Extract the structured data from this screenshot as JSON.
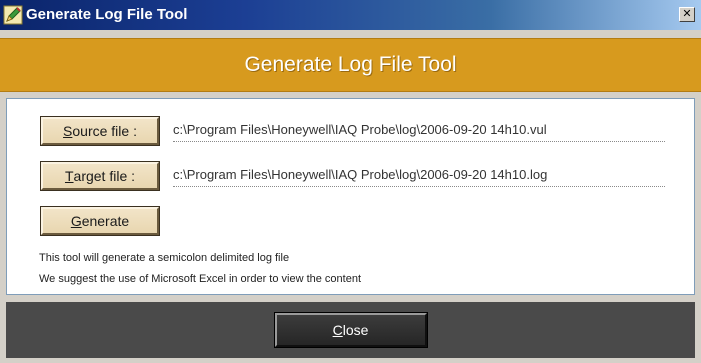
{
  "window": {
    "title": "Generate Log File Tool",
    "app_icon": "pen-tool-icon",
    "close_glyph": "✕"
  },
  "header": {
    "title": "Generate Log File Tool",
    "color": "#d79a1e"
  },
  "buttons": {
    "source": {
      "mnemonic": "S",
      "rest": "ource file :"
    },
    "target": {
      "mnemonic": "T",
      "rest": "arget file :"
    },
    "generate": {
      "mnemonic": "G",
      "rest": "enerate"
    }
  },
  "paths": {
    "source": "c:\\Program Files\\Honeywell\\IAQ Probe\\log\\2006-09-20 14h10.vul",
    "target": "c:\\Program Files\\Honeywell\\IAQ Probe\\log\\2006-09-20 14h10.log"
  },
  "notes": {
    "line1": "This tool will generate a  semicolon delimited log file",
    "line2": "We suggest the use of Microsoft Excel in order to view the content"
  },
  "footer": {
    "close": {
      "mnemonic": "C",
      "rest": "lose"
    }
  }
}
